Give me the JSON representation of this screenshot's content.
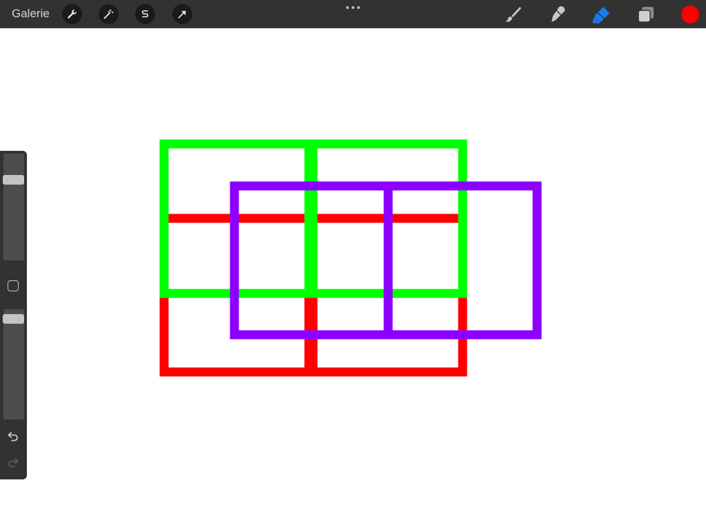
{
  "toolbar": {
    "gallery_label": "Galerie",
    "left_tools": [
      {
        "icon": "wrench-icon"
      },
      {
        "icon": "magic-wand-icon"
      },
      {
        "icon": "s-curve-icon"
      },
      {
        "icon": "arrow-icon"
      }
    ],
    "right_tools": [
      {
        "icon": "brush-icon",
        "active": false
      },
      {
        "icon": "smudge-icon",
        "active": false
      },
      {
        "icon": "eraser-icon",
        "active": true
      },
      {
        "icon": "layers-icon",
        "active": false
      }
    ],
    "current_color": "#ff0000",
    "accent_color": "#1a7cf5"
  },
  "sidebar": {
    "brush_size_level": 0.78,
    "opacity_level": 0.95,
    "icons": [
      "undo-icon",
      "redo-icon"
    ]
  },
  "canvas": {
    "background": "#ffffff",
    "drawing_colors": {
      "green": "#00ff00",
      "red": "#ff0000",
      "purple": "#8c00ff"
    }
  }
}
